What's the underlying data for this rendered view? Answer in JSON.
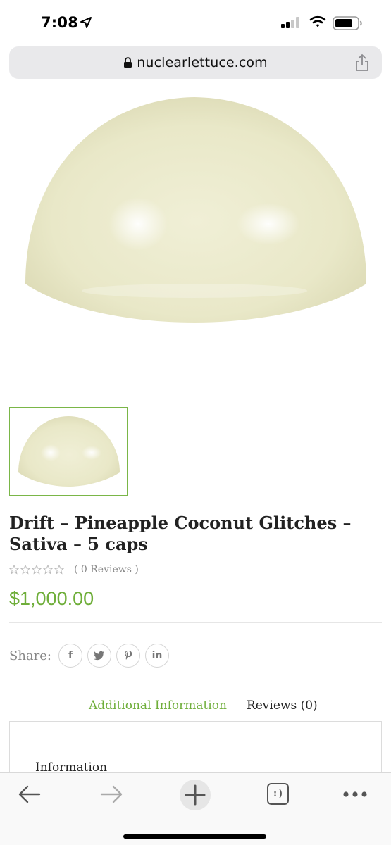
{
  "status_bar": {
    "time": "7:08",
    "icons": [
      "location-arrow-icon",
      "cellular-signal-icon",
      "wifi-icon",
      "battery-icon"
    ]
  },
  "browser": {
    "url": "nuclearlettuce.com",
    "icons": [
      "lock-icon",
      "share-icon"
    ]
  },
  "product": {
    "title": "Drift – Pineapple Coconut Glitches – Sativa – 5 caps",
    "reviews": "( 0 Reviews )",
    "rating": 0,
    "rating_max": 5,
    "price": "$1,000.00",
    "image_color": "#ecebcd"
  },
  "share": {
    "label": "Share:",
    "networks": [
      {
        "name": "facebook",
        "glyph": "f"
      },
      {
        "name": "twitter",
        "glyph": "t"
      },
      {
        "name": "pinterest",
        "glyph": "p"
      },
      {
        "name": "linkedin",
        "glyph": "in"
      }
    ]
  },
  "tabs": [
    {
      "label": "Additional Information",
      "active": true
    },
    {
      "label": "Reviews (0)",
      "active": false
    }
  ],
  "panel": {
    "heading": "Information"
  },
  "toolbar": {
    "icons": [
      "back-arrow-icon",
      "forward-arrow-icon",
      "new-tab-plus-icon",
      "tabs-icon",
      "more-dots-icon"
    ],
    "tabs_glyph": ":)"
  },
  "colors": {
    "accent": "#6fae3a",
    "thumb_border": "#7ab648"
  }
}
